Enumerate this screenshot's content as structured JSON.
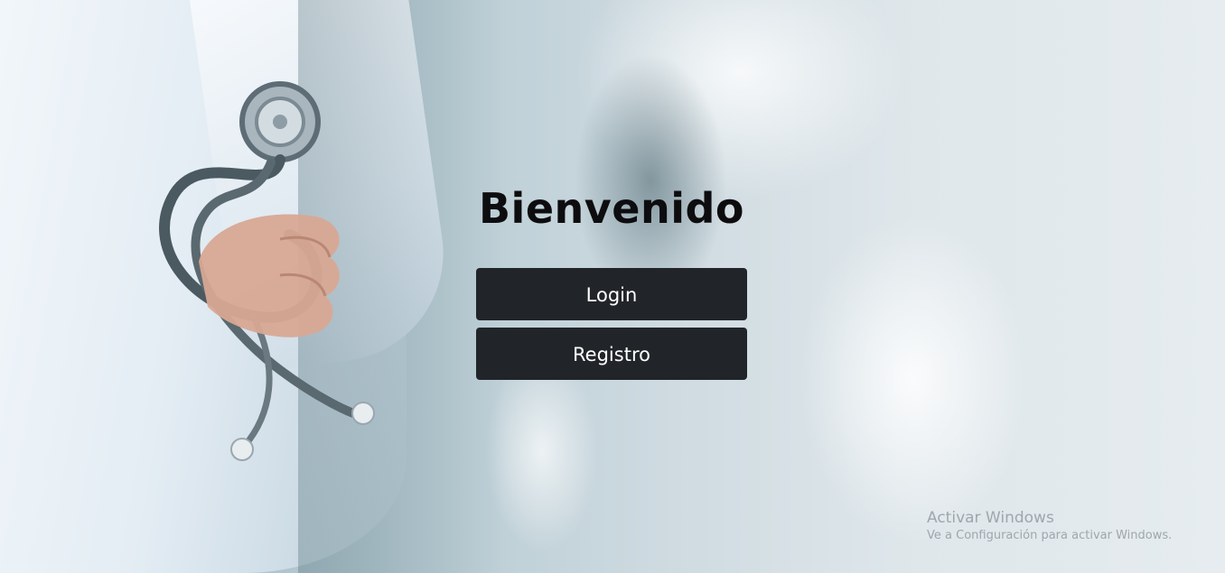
{
  "page": {
    "title": "Bienvenido"
  },
  "actions": {
    "login_label": "Login",
    "register_label": "Registro"
  },
  "watermark": {
    "title": "Activar Windows",
    "subtitle": "Ve a Configuración para activar Windows."
  },
  "colors": {
    "button_background": "#212529",
    "button_text": "#ffffff",
    "title_text": "#0d0d0f"
  },
  "background": {
    "icon": "doctor-stethoscope-photo"
  }
}
